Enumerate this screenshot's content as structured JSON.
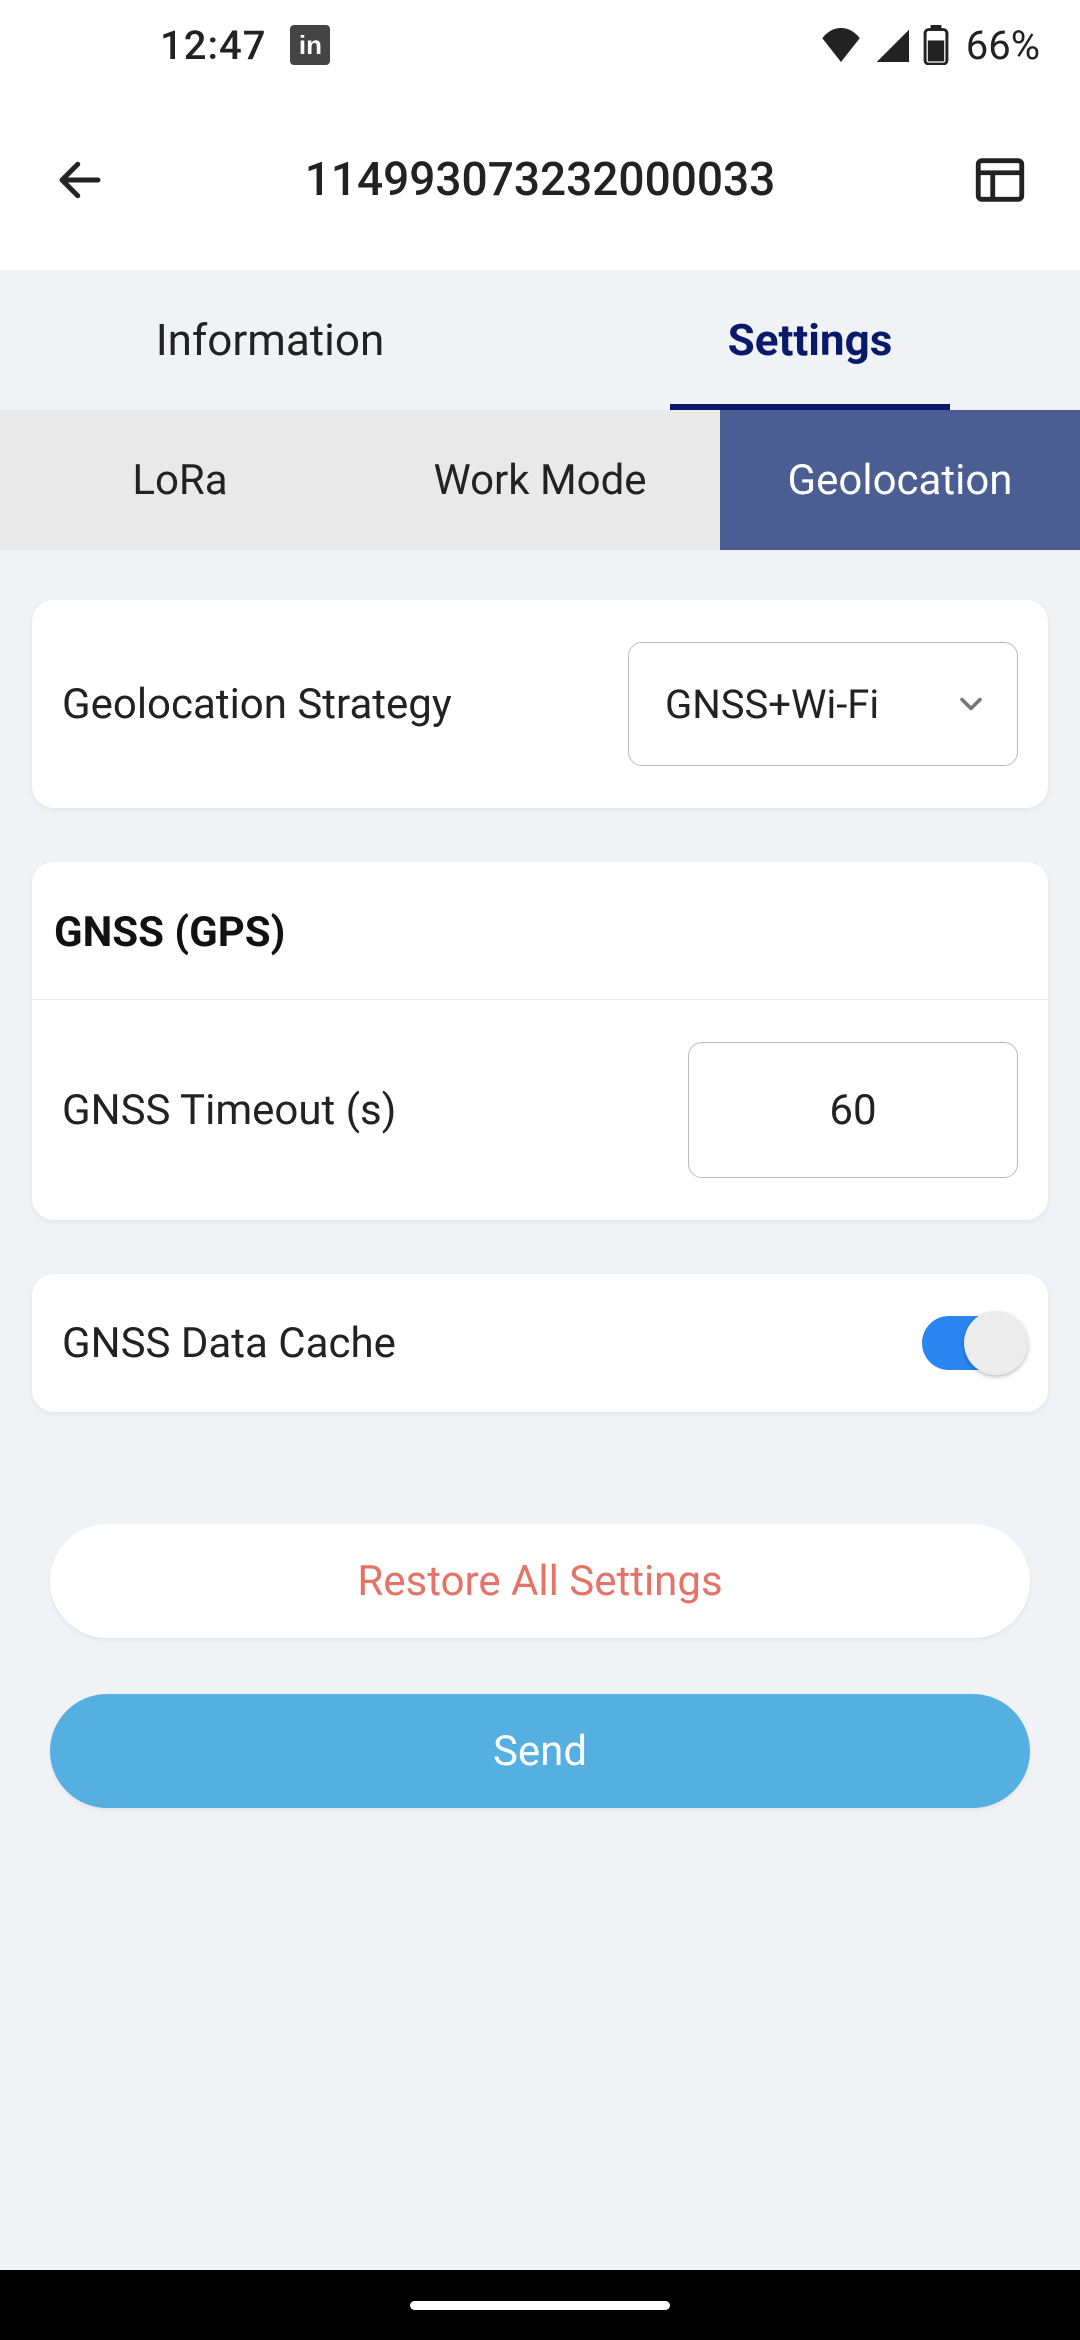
{
  "status": {
    "time": "12:47",
    "battery_text": "66%"
  },
  "header": {
    "title": "114993073232000033"
  },
  "primary_tabs": {
    "items": [
      {
        "label": "Information"
      },
      {
        "label": "Settings"
      }
    ],
    "active_index": 1
  },
  "secondary_tabs": {
    "items": [
      {
        "label": "LoRa"
      },
      {
        "label": "Work Mode"
      },
      {
        "label": "Geolocation"
      }
    ],
    "active_index": 2
  },
  "geolocation_strategy": {
    "label": "Geolocation Strategy",
    "selected": "GNSS+Wi-Fi"
  },
  "gnss_section": {
    "title": "GNSS (GPS)",
    "timeout_label": "GNSS Timeout (s)",
    "timeout_value": "60"
  },
  "gnss_cache": {
    "label": "GNSS Data Cache",
    "enabled": true
  },
  "buttons": {
    "restore": "Restore All Settings",
    "send": "Send"
  }
}
